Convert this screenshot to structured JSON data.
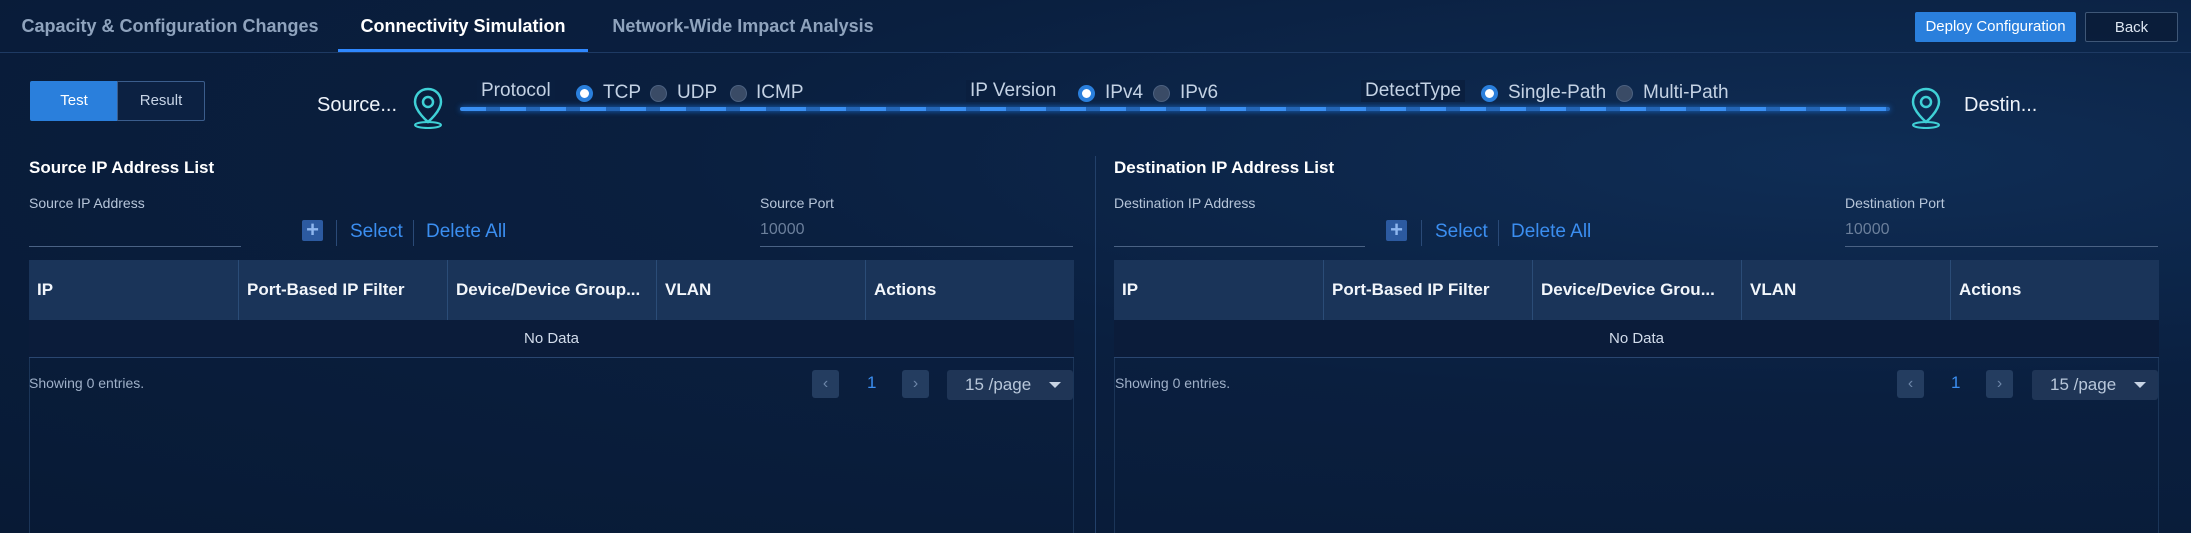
{
  "tabs": [
    {
      "label": "Capacity & Configuration Changes"
    },
    {
      "label": "Connectivity Simulation"
    },
    {
      "label": "Network-Wide Impact Analysis"
    }
  ],
  "actions": {
    "deploy": "Deploy Configuration",
    "back": "Back"
  },
  "mode": {
    "test": "Test",
    "result": "Result",
    "selected": "Test"
  },
  "path": {
    "source_label": "Source...",
    "destination_label": "Destin...",
    "protocol": {
      "label": "Protocol",
      "options": [
        "TCP",
        "UDP",
        "ICMP"
      ],
      "selected": "TCP"
    },
    "ip_version": {
      "label": "IP Version",
      "options": [
        "IPv4",
        "IPv6"
      ],
      "selected": "IPv4"
    },
    "detect_type": {
      "label": "DetectType",
      "options": [
        "Single-Path",
        "Multi-Path"
      ],
      "selected": "Single-Path"
    }
  },
  "source": {
    "title": "Source IP Address List",
    "address_label": "Source IP Address",
    "address_value": "",
    "select": "Select",
    "delete_all": "Delete All",
    "port_label": "Source Port",
    "port_placeholder": "10000",
    "columns": [
      "IP",
      "Port-Based IP Filter",
      "Device/Device Group...",
      "VLAN",
      "Actions"
    ],
    "empty": "No Data",
    "showing": "Showing 0 entries.",
    "page": "1",
    "page_size": "15 /page"
  },
  "destination": {
    "title": "Destination IP Address List",
    "address_label": "Destination IP Address",
    "address_value": "",
    "select": "Select",
    "delete_all": "Delete All",
    "port_label": "Destination Port",
    "port_placeholder": "10000",
    "columns": [
      "IP",
      "Port-Based IP Filter",
      "Device/Device Grou...",
      "VLAN",
      "Actions"
    ],
    "empty": "No Data",
    "showing": "Showing 0 entries.",
    "page": "1",
    "page_size": "15 /page"
  },
  "colors": {
    "accent": "#2a7fdc",
    "link": "#3b8ef0",
    "background": "#0a1f3f",
    "pin": "#3fd0d6"
  }
}
